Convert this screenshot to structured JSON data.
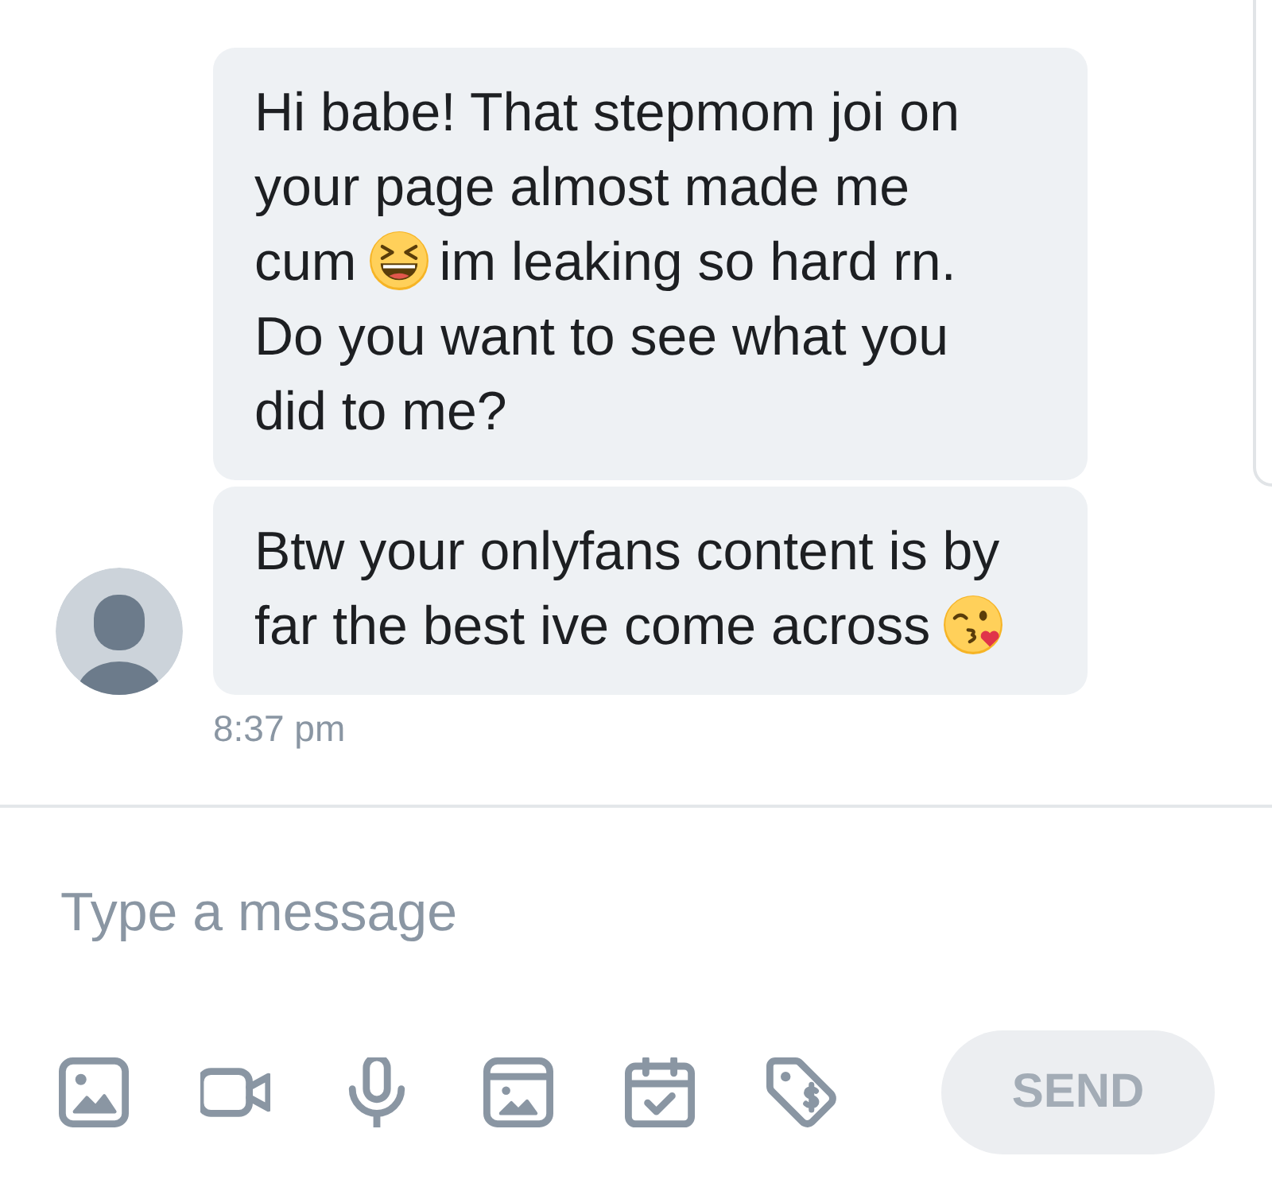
{
  "thread": {
    "messages": [
      {
        "segments": [
          {
            "kind": "text",
            "text": "Hi babe! That stepmom joi on your page almost made me cum"
          },
          {
            "kind": "laughing"
          },
          {
            "kind": "text",
            "text": "im leaking so hard rn. Do you want to see what you did to me?"
          }
        ]
      },
      {
        "segments": [
          {
            "kind": "text",
            "text": "Btw your onlyfans content is by far the best ive come across"
          },
          {
            "kind": "kiss"
          }
        ]
      }
    ],
    "time": "8:37 pm"
  },
  "composer": {
    "placeholder": "Type a message"
  },
  "send_button": {
    "label": "SEND",
    "disabled": true
  }
}
